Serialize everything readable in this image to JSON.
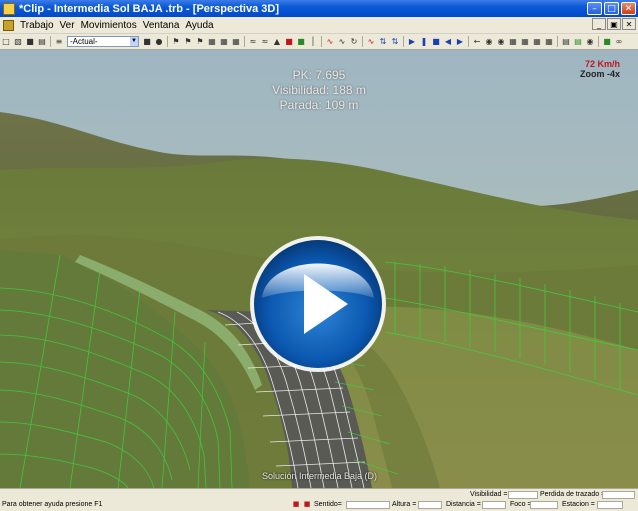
{
  "window": {
    "title": "*Clip - Intermedia Sol BAJA .trb - [Perspectiva 3D]"
  },
  "menu": {
    "items": [
      "Trabajo",
      "Ver",
      "Movimientos",
      "Ventana",
      "Ayuda"
    ]
  },
  "toolbar": {
    "view_select": "-Actual-"
  },
  "hud": {
    "pk": "PK: 7.695",
    "visibilidad": "Visibilidad: 188 m",
    "parada": "Parada: 109 m",
    "speed": "72 Km/h",
    "zoom": "Zoom -4x"
  },
  "viewport": {
    "caption": "Solución Intermedia Baja (D)"
  },
  "status": {
    "help": "Para obtener ayuda presione F1",
    "visibilidad_label": "Visibilidad =",
    "perdida_label": "Perdida de trazado =",
    "sentido_label": "Sentido=",
    "altura_label": "Altura =",
    "distancia_label": "Distancia =",
    "foco_label": "Foco =",
    "estacion_label": "Estacion ="
  },
  "colors": {
    "titlebar": "#0a5ad7",
    "speed": "#c01818",
    "mesh": "#3fd03f",
    "terrain": "#6f7a3c",
    "sky": "#a9bfc0"
  }
}
